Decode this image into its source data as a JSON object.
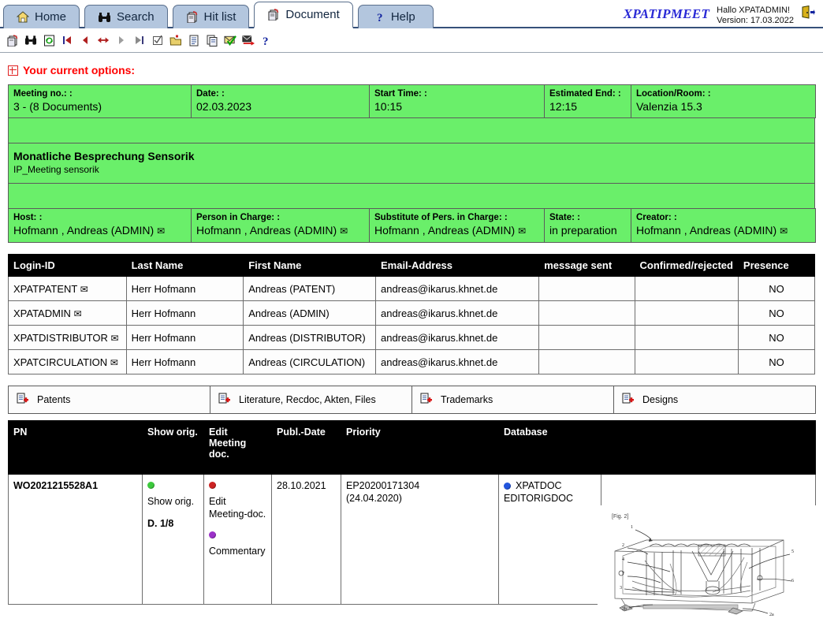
{
  "header": {
    "tabs": [
      {
        "label": "Home",
        "icon": "home-icon",
        "active": false
      },
      {
        "label": "Search",
        "icon": "binoculars-icon",
        "active": false
      },
      {
        "label": "Hit list",
        "icon": "document-refresh-icon",
        "active": false
      },
      {
        "label": "Document",
        "icon": "document-refresh-icon",
        "active": true
      },
      {
        "label": "Help",
        "icon": "question-mark-icon",
        "active": false
      }
    ],
    "brand": "XPATIPMEET",
    "greeting": "Hallo XPATADMIN!",
    "version": "Version: 17.03.2022",
    "logout_icon": "exit-door-icon"
  },
  "toolbar": {
    "buttons": [
      {
        "name": "document-refresh-icon",
        "title": "Document"
      },
      {
        "name": "binoculars-icon",
        "title": "Search"
      },
      {
        "name": "refresh-document-icon",
        "title": "Refresh"
      },
      {
        "name": "first-record-icon",
        "title": "First"
      },
      {
        "name": "previous-record-icon",
        "title": "Previous"
      },
      {
        "name": "expand-arrows-icon",
        "title": "Expand"
      },
      {
        "name": "next-record-icon",
        "title": "Next"
      },
      {
        "name": "last-record-icon",
        "title": "Last"
      },
      {
        "name": "checkbox-icon",
        "title": "Select"
      },
      {
        "name": "open-folder-icon",
        "title": "Open folder"
      },
      {
        "name": "page-icon",
        "title": "Page"
      },
      {
        "name": "copy-icon",
        "title": "Copy"
      },
      {
        "name": "mail-check-icon",
        "title": "Mail sent"
      },
      {
        "name": "mail-forward-icon",
        "title": "Forward mail"
      },
      {
        "name": "question-mark-icon",
        "title": "Help"
      }
    ]
  },
  "options": {
    "label": "Your current options:",
    "expand_icon": "expand-plus-icon"
  },
  "meeting": {
    "row1": [
      {
        "label": "Meeting no.: :",
        "value": "3 - (8 Documents)",
        "bg": "white"
      },
      {
        "label": "Date: :",
        "value": "02.03.2023",
        "bg": "green"
      },
      {
        "label": "Start Time: :",
        "value": "10:15",
        "bg": "green"
      },
      {
        "label": "Estimated End: :",
        "value": "12:15",
        "bg": "green"
      },
      {
        "label": "Location/Room: :",
        "value": "Valenzia 15.3",
        "bg": "green"
      }
    ],
    "title": "Monatliche Besprechung Sensorik",
    "subtitle": "IP_Meeting sensorik",
    "row3": [
      {
        "label": "Host: :",
        "value": "Hofmann , Andreas (ADMIN)",
        "bg": "green",
        "mail": true
      },
      {
        "label": "Person in Charge: :",
        "value": "Hofmann , Andreas (ADMIN)",
        "bg": "green",
        "mail": true
      },
      {
        "label": "Substitute of Pers. in Charge: :",
        "value": "Hofmann , Andreas (ADMIN)",
        "bg": "white",
        "mail": true
      },
      {
        "label": "State: :",
        "value": "in preparation",
        "bg": "yellow",
        "mail": false
      },
      {
        "label": "Creator: :",
        "value": "Hofmann , Andreas (ADMIN)",
        "bg": "white",
        "mail": true
      }
    ]
  },
  "participants": {
    "columns": [
      "Login-ID",
      "Last Name",
      "First Name",
      "Email-Address",
      "message sent",
      "Confirmed/rejected",
      "Presence"
    ],
    "rows": [
      {
        "login": "XPATPATENT",
        "last": "Herr Hofmann",
        "first": "Andreas (PATENT)",
        "email": "andreas@ikarus.khnet.de",
        "sent": "",
        "confirmed": "",
        "presence": "NO"
      },
      {
        "login": "XPATADMIN",
        "last": "Herr Hofmann",
        "first": "Andreas (ADMIN)",
        "email": "andreas@ikarus.khnet.de",
        "sent": "",
        "confirmed": "",
        "presence": "NO"
      },
      {
        "login": "XPATDISTRIBUTOR",
        "last": "Herr Hofmann",
        "first": "Andreas (DISTRIBUTOR)",
        "email": "andreas@ikarus.khnet.de",
        "sent": "",
        "confirmed": "",
        "presence": "NO"
      },
      {
        "login": "XPATCIRCULATION",
        "last": "Herr Hofmann",
        "first": "Andreas (CIRCULATION)",
        "email": "andreas@ikarus.khnet.de",
        "sent": "",
        "confirmed": "",
        "presence": "NO"
      }
    ]
  },
  "doc_tabs": [
    {
      "label": "Patents",
      "icon": "add-document-icon"
    },
    {
      "label": "Literature, Recdoc, Akten, Files",
      "icon": "add-document-icon"
    },
    {
      "label": "Trademarks",
      "icon": "add-document-icon"
    },
    {
      "label": "Designs",
      "icon": "add-document-icon"
    }
  ],
  "documents": {
    "columns": [
      "PN",
      "Show orig.",
      "Edit Meeting doc.",
      "Publ.-Date",
      "Priority",
      "Database",
      ""
    ],
    "rows": [
      {
        "pn": "WO2021215528A1",
        "show_orig_label": "Show orig.",
        "show_orig_count": "D. 1/8",
        "edit_label": "Edit Meeting-doc.",
        "commentary_label": "Commentary",
        "publ_date": "28.10.2021",
        "priority_number": "EP20200171304",
        "priority_date": "(24.04.2020)",
        "database_main": "XPATDOC",
        "database_sub": "EDITORIGDOC"
      }
    ]
  },
  "figure": {
    "caption": "[Fig. 2]",
    "callouts": [
      "1",
      "2",
      "4",
      "7",
      "3",
      "2b",
      "5",
      "6",
      "2a"
    ]
  },
  "colors": {
    "green": "#6aef6a",
    "yellow": "#ffff00",
    "pn_yellow": "#e2f24b",
    "pink": "#ff5fb4",
    "brand_blue": "#2a2ad6",
    "options_red": "#ff0000",
    "tab_blue": "#b3c6de"
  }
}
